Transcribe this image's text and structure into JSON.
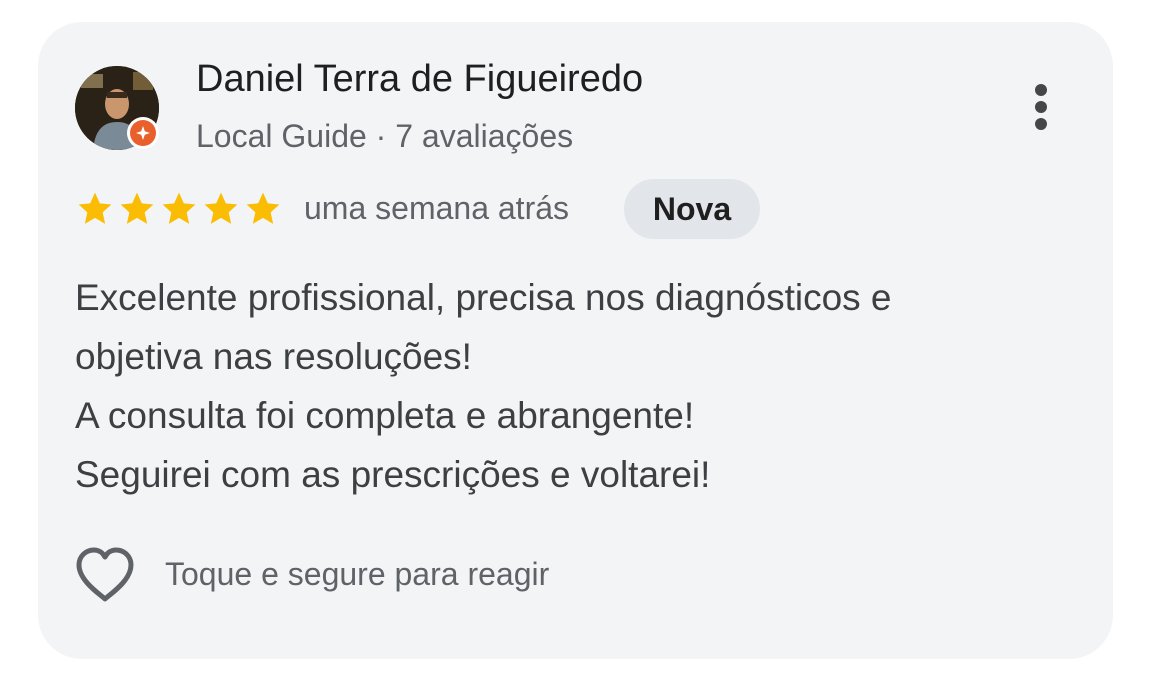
{
  "review": {
    "author_name": "Daniel Terra de Figueiredo",
    "author_meta": "Local Guide · 7 avaliações",
    "rating": 5,
    "rating_max": 5,
    "time_ago": "uma semana atrás",
    "badge": "Nova",
    "text_lines": [
      "Excelente profissional, precisa nos diagnósticos e",
      "objetiva nas resoluções!",
      "A consulta foi completa e abrangente!",
      "Seguirei com as prescrições e voltarei!"
    ],
    "react_hint": "Toque e segure para reagir"
  },
  "icons": {
    "avatar": "user-photo",
    "guide_badge": "local-guide-badge-icon",
    "more": "more-vert-icon",
    "star": "star-icon",
    "heart": "heart-outline-icon"
  },
  "colors": {
    "card_bg": "#f3f4f6",
    "star": "#fbbc04",
    "guide_badge": "#e8602c",
    "badge_bg": "#e2e5e9",
    "text_primary": "#1f1f1f",
    "text_secondary": "#5f6368"
  }
}
